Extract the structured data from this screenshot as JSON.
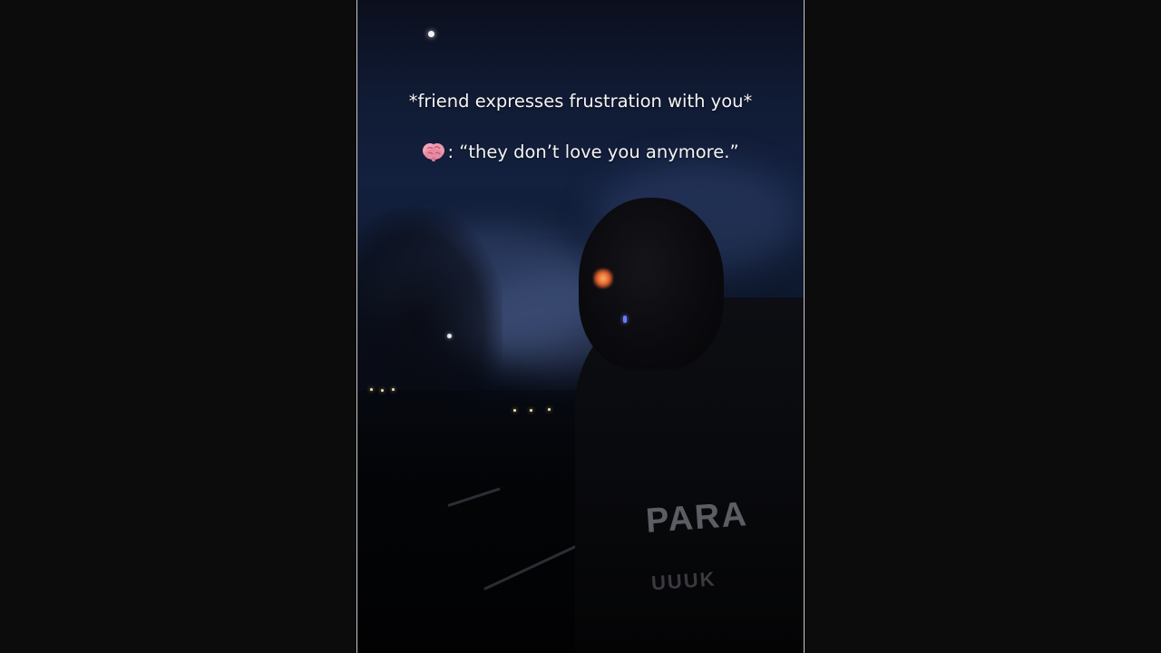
{
  "video": {
    "caption_line1": "*friend expresses frustration with you*",
    "caption_line2": ": “they don’t love you anymore.”",
    "caption_icon": "brain-icon",
    "background_color": "#0c0c0c",
    "text_color": "#f4f4f4"
  }
}
